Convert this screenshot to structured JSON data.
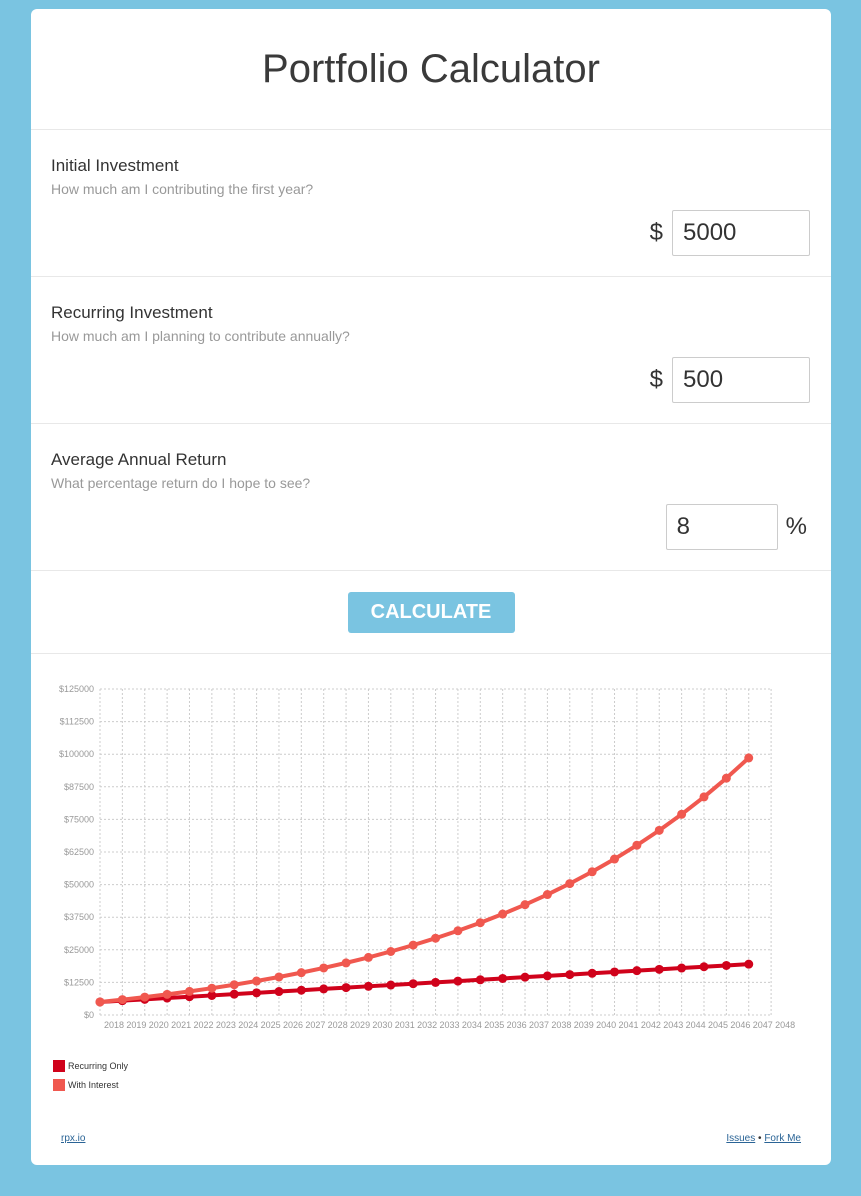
{
  "header": {
    "title": "Portfolio Calculator"
  },
  "initial": {
    "label": "Initial Investment",
    "help": "How much am I contributing the first year?",
    "prefix": "$",
    "value": "5000"
  },
  "recurring": {
    "label": "Recurring Investment",
    "help": "How much am I planning to contribute annually?",
    "prefix": "$",
    "value": "500"
  },
  "returnRate": {
    "label": "Average Annual Return",
    "help": "What percentage return do I hope to see?",
    "value": "8",
    "suffix": "%"
  },
  "calculate_label": "CALCULATE",
  "legend": {
    "items": [
      {
        "label": "Recurring Only",
        "color": "#d0021b"
      },
      {
        "label": "With Interest",
        "color": "#f0584f"
      }
    ]
  },
  "footer": {
    "left_link": "rpx.io",
    "issues_link": "Issues",
    "separator": "•",
    "fork_link": "Fork Me"
  },
  "colors": {
    "background": "#7ac4e1",
    "button": "#7ac4e1",
    "recurring": "#d0021b",
    "interest": "#f0584f",
    "grid": "#cccccc"
  },
  "chart_data": {
    "type": "line",
    "x": [
      2018,
      2019,
      2020,
      2021,
      2022,
      2023,
      2024,
      2025,
      2026,
      2027,
      2028,
      2029,
      2030,
      2031,
      2032,
      2033,
      2034,
      2035,
      2036,
      2037,
      2038,
      2039,
      2040,
      2041,
      2042,
      2043,
      2044,
      2045,
      2046,
      2047,
      2048
    ],
    "x_labels": [
      "2018",
      "2019",
      "2020",
      "2021",
      "2022",
      "2023",
      "2024",
      "2025",
      "2026",
      "2027",
      "2028",
      "2029",
      "2030",
      "2031",
      "2032",
      "2033",
      "2034",
      "2035",
      "2036",
      "2037",
      "2038",
      "2039",
      "2040",
      "2041",
      "2042",
      "2043",
      "2044",
      "2045",
      "2046",
      "2047",
      "2048"
    ],
    "y_ticks": [
      "$0",
      "$12500",
      "$25000",
      "$37500",
      "$50000",
      "$62500",
      "$75000",
      "$87500",
      "$100000",
      "$112500",
      "$125000"
    ],
    "ylim": [
      0,
      125000
    ],
    "grid": true,
    "legend_position": "bottom-left",
    "series": [
      {
        "name": "Recurring Only",
        "color": "#d0021b",
        "values": [
          5000,
          5500,
          6000,
          6500,
          7000,
          7500,
          8000,
          8500,
          9000,
          9500,
          10000,
          10500,
          11000,
          11500,
          12000,
          12500,
          13000,
          13500,
          14000,
          14500,
          15000,
          15500,
          16000,
          16500,
          17000,
          17500,
          18000,
          18500,
          19000,
          19500
        ]
      },
      {
        "name": "With Interest",
        "color": "#f0584f",
        "values": [
          5000,
          5900,
          6872,
          7922,
          9056,
          10280,
          11603,
          13031,
          14574,
          16240,
          18039,
          19982,
          22081,
          24347,
          26795,
          29439,
          32294,
          35378,
          38708,
          42305,
          46189,
          50384,
          54915,
          59808,
          65093,
          70800,
          76964,
          83621,
          90811,
          98576
        ]
      }
    ]
  }
}
